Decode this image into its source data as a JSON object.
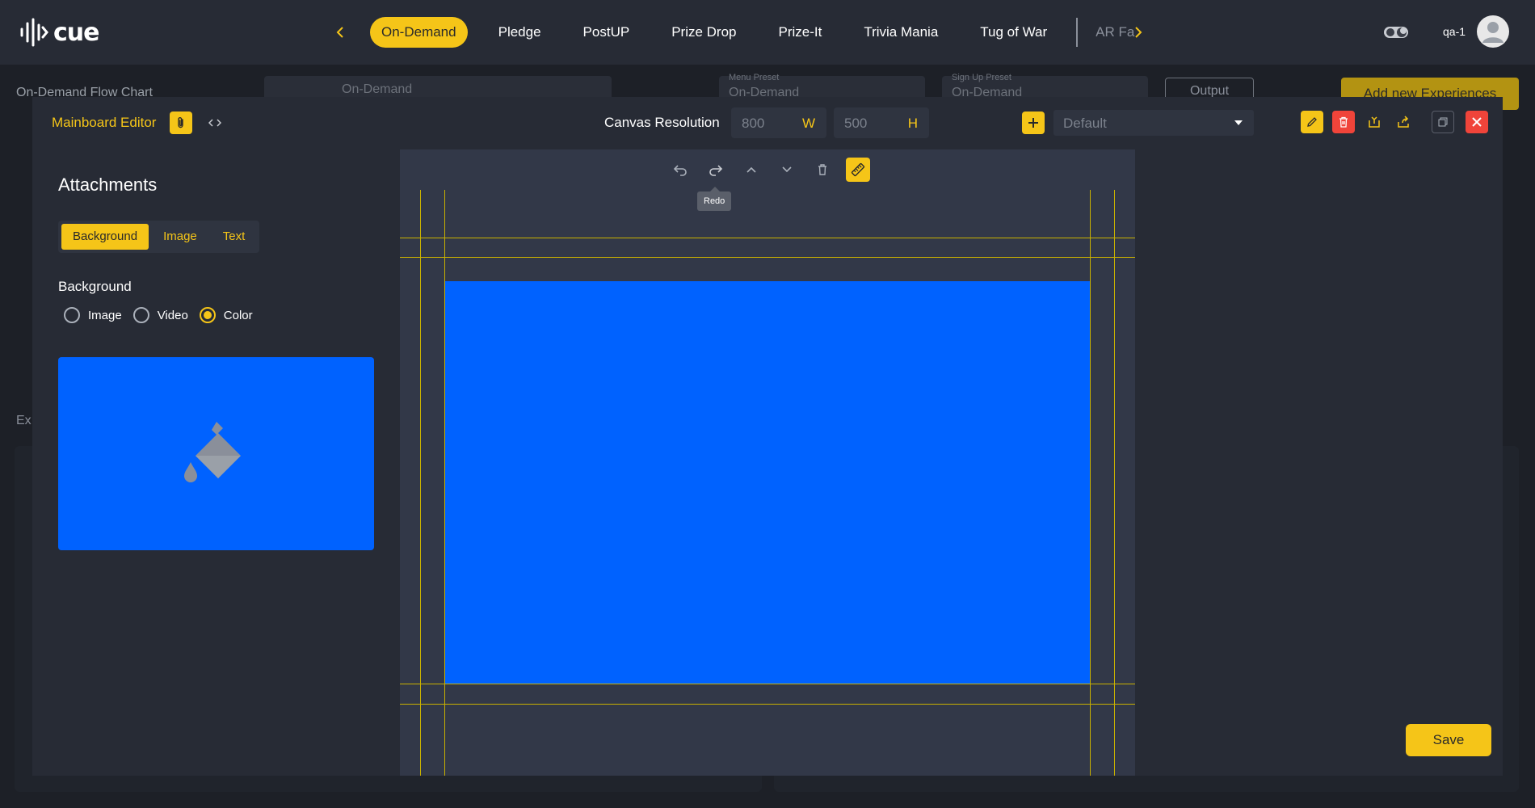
{
  "app": {
    "logo_text": "cue",
    "user_name": "qa-1"
  },
  "nav": {
    "tabs": [
      {
        "label": "On-Demand",
        "active": true
      },
      {
        "label": "Pledge"
      },
      {
        "label": "PostUP"
      },
      {
        "label": "Prize Drop"
      },
      {
        "label": "Prize-It"
      },
      {
        "label": "Trivia Mania"
      },
      {
        "label": "Tug of War"
      }
    ],
    "overflow_tab": "AR Fa"
  },
  "background_page": {
    "title": "On-Demand Flow Chart",
    "flow_select_value": "On-Demand",
    "menu_preset": {
      "label": "Menu Preset",
      "value": "On-Demand"
    },
    "signup_preset": {
      "label": "Sign Up Preset",
      "value": "On-Demand"
    },
    "output_label": "Output",
    "add_button_label": "Add new Experiences",
    "section_label": "Ex"
  },
  "modal": {
    "title": "Mainboard Editor",
    "canvas_resolution_label": "Canvas Resolution",
    "width_value": "800",
    "width_unit": "W",
    "height_value": "500",
    "height_unit": "H",
    "preset_value": "Default",
    "attachments_title": "Attachments",
    "attachment_tabs": [
      {
        "label": "Background",
        "active": true
      },
      {
        "label": "Image"
      },
      {
        "label": "Text"
      }
    ],
    "background_label": "Background",
    "background_options": [
      {
        "label": "Image",
        "checked": false
      },
      {
        "label": "Video",
        "checked": false
      },
      {
        "label": "Color",
        "checked": true
      }
    ],
    "background_color": "#0062ff",
    "tooltip": "Redo",
    "save_label": "Save"
  },
  "colors": {
    "accent": "#f5c518",
    "danger": "#f0443a",
    "canvas_fill": "#0062ff",
    "guide_line": "#c9b100"
  }
}
